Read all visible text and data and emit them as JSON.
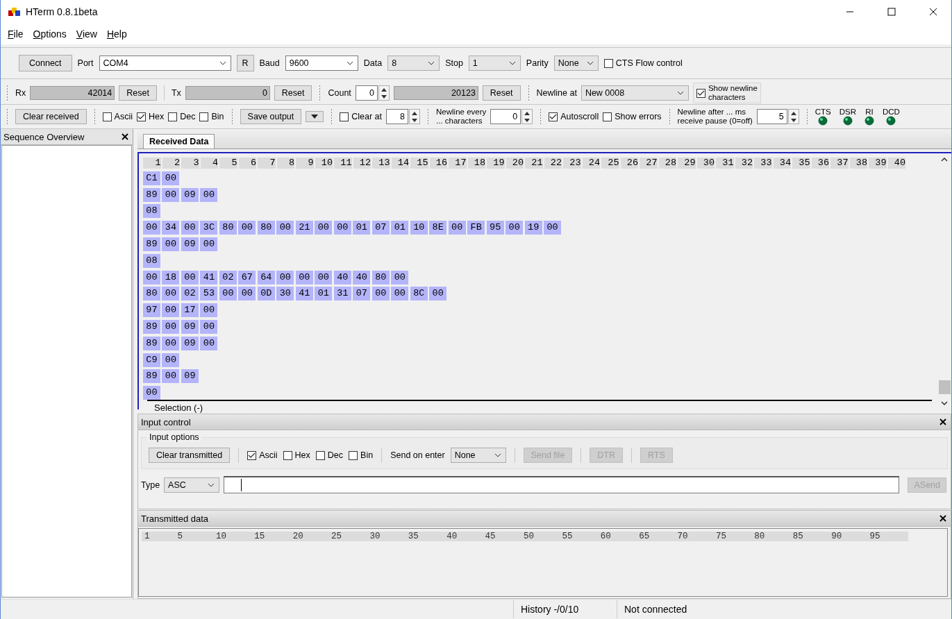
{
  "window": {
    "title": "HTerm 0.8.1beta"
  },
  "menu": [
    "File",
    "Options",
    "View",
    "Help"
  ],
  "connection": {
    "connect": "Connect",
    "port": {
      "label": "Port",
      "value": "COM4"
    },
    "refresh": "R",
    "baud": {
      "label": "Baud",
      "value": "9600"
    },
    "data": {
      "label": "Data",
      "value": "8"
    },
    "stop": {
      "label": "Stop",
      "value": "1"
    },
    "parity": {
      "label": "Parity",
      "value": "None"
    },
    "cts_flow": {
      "label": "CTS Flow control",
      "checked": false
    }
  },
  "counters": {
    "rx": {
      "label": "Rx",
      "value": "42014",
      "reset": "Reset"
    },
    "tx": {
      "label": "Tx",
      "value": "0",
      "reset": "Reset"
    },
    "count": {
      "label": "Count",
      "value": "0",
      "total": "20123",
      "reset": "Reset"
    },
    "newline_at": {
      "label": "Newline at",
      "value": "New 0008"
    },
    "show_newline": {
      "lines": [
        "Show newline",
        "characters"
      ],
      "checked": true
    }
  },
  "display": {
    "clear_received": "Clear received",
    "formats": [
      {
        "label": "Ascii",
        "checked": false
      },
      {
        "label": "Hex",
        "checked": true
      },
      {
        "label": "Dec",
        "checked": false
      },
      {
        "label": "Bin",
        "checked": false
      }
    ],
    "save_output": "Save output",
    "clear_at": {
      "label": "Clear at",
      "checked": false,
      "value": "8"
    },
    "newline_every": {
      "lines": [
        "Newline every",
        "... characters"
      ],
      "value": "0"
    },
    "autoscroll": {
      "label": "Autoscroll",
      "checked": true
    },
    "show_errors": {
      "label": "Show errors",
      "checked": false
    },
    "newline_after": {
      "lines": [
        "Newline after ... ms",
        "receive pause (0=off)"
      ],
      "value": "5"
    },
    "signals": [
      "CTS",
      "DSR",
      "RI",
      "DCD"
    ]
  },
  "sequence_overview": {
    "title": "Sequence Overview"
  },
  "received": {
    "tab": {
      "label": "Received Data",
      "selected": true
    },
    "columns": [
      "1",
      "2",
      "3",
      "4",
      "5",
      "6",
      "7",
      "8",
      "9",
      "10",
      "11",
      "12",
      "13",
      "14",
      "15",
      "16",
      "17",
      "18",
      "19",
      "20",
      "21",
      "22",
      "23",
      "24",
      "25",
      "26",
      "27",
      "28",
      "29",
      "30",
      "31",
      "32",
      "33",
      "34",
      "35",
      "36",
      "37",
      "38",
      "39",
      "40"
    ],
    "rows": [
      [
        "C1",
        "00"
      ],
      [
        "89",
        "00",
        "09",
        "00"
      ],
      [
        "08"
      ],
      [
        "00",
        "34",
        "00",
        "3C",
        "80",
        "00",
        "80",
        "00",
        "21",
        "00",
        "00",
        "01",
        "07",
        "01",
        "10",
        "8E",
        "00",
        "FB",
        "95",
        "00",
        "19",
        "00"
      ],
      [
        "89",
        "00",
        "09",
        "00"
      ],
      [
        "08"
      ],
      [
        "00",
        "18",
        "00",
        "41",
        "02",
        "67",
        "64",
        "00",
        "00",
        "00",
        "40",
        "40",
        "80",
        "00"
      ],
      [
        "80",
        "00",
        "02",
        "53",
        "00",
        "00",
        "0D",
        "30",
        "41",
        "01",
        "31",
        "07",
        "00",
        "00",
        "8C",
        "00"
      ],
      [
        "97",
        "00",
        "17",
        "00"
      ],
      [
        "89",
        "00",
        "09",
        "00"
      ],
      [
        "89",
        "00",
        "09",
        "00"
      ],
      [
        "C9",
        "00"
      ],
      [
        "89",
        "00",
        "09"
      ],
      [
        "00"
      ]
    ],
    "selection": "Selection (-)"
  },
  "input_control": {
    "title": "Input control",
    "group": "Input options",
    "clear_transmitted": "Clear transmitted",
    "formats": [
      {
        "label": "Ascii",
        "checked": true
      },
      {
        "label": "Hex",
        "checked": false
      },
      {
        "label": "Dec",
        "checked": false
      },
      {
        "label": "Bin",
        "checked": false
      }
    ],
    "send_on_enter": {
      "label": "Send on enter",
      "value": "None"
    },
    "buttons": [
      {
        "label": "Send file",
        "disabled": true
      },
      {
        "label": "DTR",
        "disabled": true
      },
      {
        "label": "RTS",
        "disabled": true
      }
    ],
    "type": {
      "label": "Type",
      "value": "ASC"
    },
    "asend": {
      "label": "ASend",
      "disabled": true
    }
  },
  "transmitted": {
    "title": "Transmitted data",
    "ruler": [
      "1",
      "5",
      "10",
      "15",
      "20",
      "25",
      "30",
      "35",
      "40",
      "45",
      "50",
      "55",
      "60",
      "65",
      "70",
      "75",
      "80",
      "85",
      "90",
      "95"
    ]
  },
  "status_bar": [
    "History -/0/10",
    "Not connected"
  ]
}
